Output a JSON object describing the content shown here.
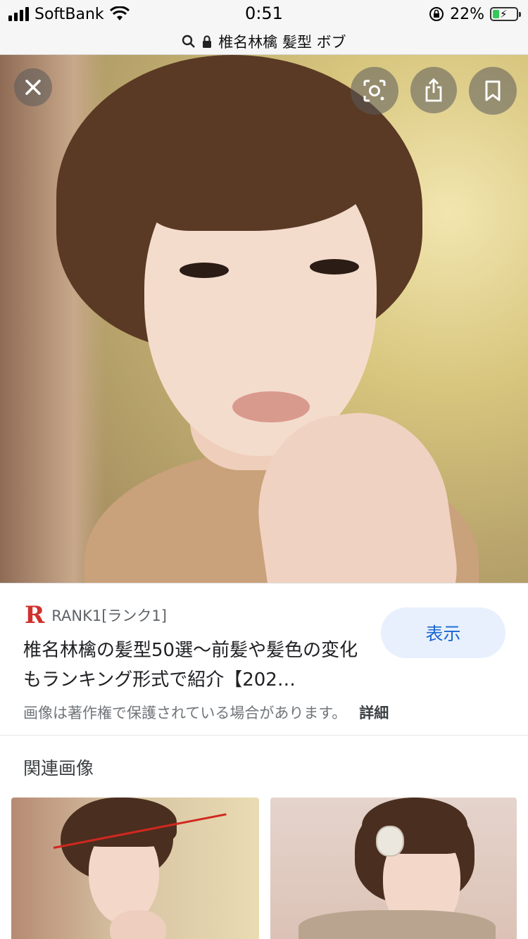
{
  "status_bar": {
    "carrier": "SoftBank",
    "time": "0:51",
    "battery_percent": "22%",
    "battery_level": 0.22,
    "icons": [
      "signal-icon",
      "wifi-icon",
      "rotation-lock-icon",
      "battery-charging-icon"
    ]
  },
  "address_bar": {
    "query": "椎名林檎 髪型 ボブ",
    "icons": [
      "search-icon",
      "lock-icon"
    ]
  },
  "image_viewer": {
    "buttons": [
      "close-icon",
      "lens-icon",
      "share-icon",
      "bookmark-icon"
    ]
  },
  "result": {
    "source_logo": "R",
    "source_name": "RANK1[ランク1]",
    "title": "椎名林檎の髪型50選〜前髪や髪色の変化もランキング形式で紹介【202…",
    "view_label": "表示",
    "copyright_note": "画像は著作権で保護されている場合があります。",
    "details_link": "詳細",
    "accent_color": "#1967d2",
    "logo_color": "#d0312d"
  },
  "related": {
    "heading": "関連画像"
  }
}
